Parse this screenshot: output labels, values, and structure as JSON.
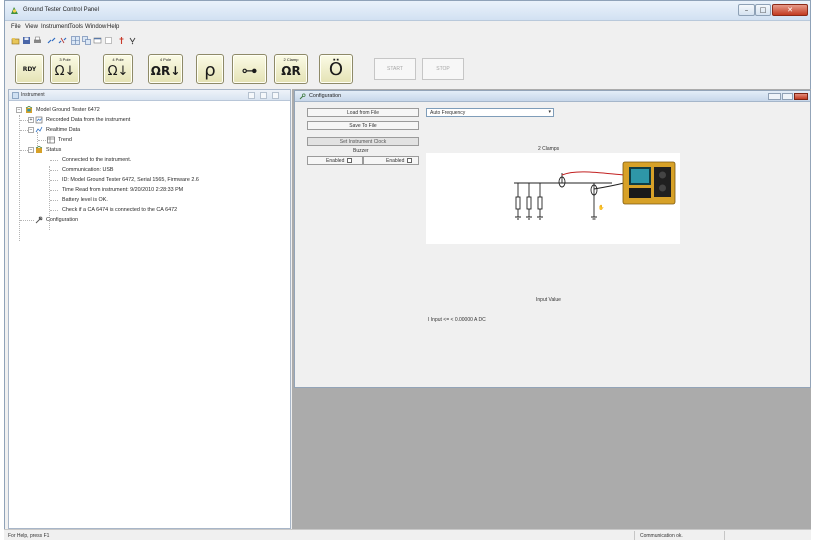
{
  "window": {
    "title": "Ground Tester Control Panel"
  },
  "menu": [
    "File",
    "View",
    "Instrument",
    "Tools",
    "Window",
    "Help"
  ],
  "small_toolbar": {
    "icons": [
      "open-icon",
      "save-icon",
      "print-icon",
      "connect-icon",
      "disconnect-icon",
      "tile-icon",
      "cascade-icon",
      "window-icon",
      "options-icon",
      "about-icon",
      "help-icon"
    ]
  },
  "big_toolbar": {
    "buttons": [
      {
        "name": "ready",
        "caption": "",
        "glyph": "RDY"
      },
      {
        "name": "3-pole",
        "caption": "3 Pole",
        "glyph": "Ω↓"
      },
      {
        "name": "4-pole",
        "caption": "4 Pole",
        "glyph": "Ω↓"
      },
      {
        "name": "4-pole-clamp",
        "caption": "4 Pole",
        "glyph": "ΩR↓"
      },
      {
        "name": "resistivity",
        "caption": "",
        "glyph": "ρ"
      },
      {
        "name": "continuity",
        "caption": "",
        "glyph": "⊶"
      },
      {
        "name": "2-clamp",
        "caption": "2 Clamp",
        "glyph": "ΩR"
      },
      {
        "name": "clamp",
        "caption": "",
        "glyph": "Ö"
      }
    ],
    "start_label": "START",
    "stop_label": "STOP"
  },
  "instrument_panel": {
    "title": "Instrument",
    "tree": {
      "root": "Model Ground Tester 6472",
      "recorded": "Recorded Data from the instrument",
      "realtime": "Realtime Data",
      "trend": "Trend",
      "status": "Status",
      "status_items": [
        "Connected to the instrument.",
        "Communication: USB",
        "ID: Model Ground Tester 6472, Serial 1565, Firmware 2.6",
        "Time Read from instrument: 9/20/2010 2:28:33 PM",
        "Battery level is OK.",
        "Check if a CA 6474 is connected to the CA 6472"
      ],
      "configuration": "Configuration"
    }
  },
  "config_window": {
    "title": "Configuration",
    "load_button": "Load from File",
    "save_button": "Save To File",
    "set_clock_button": "Set Instrument Clock",
    "buzzer_label": "Buzzer",
    "enabled_left": "Enabled",
    "enabled_right": "Enabled",
    "frequency_value": "Auto Frequency",
    "diagram_title": "2 Clamps",
    "input_title": "Input Value",
    "input_value": "I Input <= < 0.00000 A DC"
  },
  "status_bar": {
    "left": "For Help, press F1",
    "right": "Communication ok."
  },
  "colors": {
    "toolbar_btn": "#e4e2b4",
    "mdi_background": "#ababab",
    "instrument_body": "#d7a128",
    "instrument_screen": "#2e97a8",
    "wire_red": "#c22121"
  }
}
